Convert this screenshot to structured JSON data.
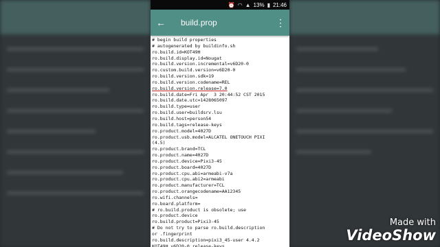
{
  "status_bar": {
    "battery": "13%",
    "time": "21:46"
  },
  "toolbar": {
    "back_icon": "arrow-left-icon",
    "title": "build.prop",
    "menu_icon": "more-vert-icon"
  },
  "lines": [
    "# begin build properties",
    "# autogenerated by buildinfo.sh",
    "ro.build.id=KOT49H",
    "ro.build.display.id=Nougat",
    "ro.build.version.incremental=v6D20-0",
    "ro.custom.build.version=v6D20-0",
    "ro.build.version.sdk=19",
    "ro.build.version.codename=REL",
    "ro.build.version.release=7.0",
    "ro.build.date=Fri Apr  3 20:44:52 CST 2015",
    "ro.build.date.utc=1428065097",
    "ro.build.type=user",
    "ro.build.user=buildsrv.lsu",
    "ro.build.host=person54",
    "ro.build.tags=release-keys",
    "ro.product.model=4027D",
    "ro.product.usb.model=ALCATEL ONETOUCH PIXI",
    "(4.5)",
    "ro.product.brand=TCL",
    "ro.product.name=4027D",
    "ro.product.device=Pixi3-45",
    "ro.product.board=4027D",
    "ro.product.cpu.abi=armeabi-v7a",
    "ro.product.cpu.abi2=armeabi",
    "ro.product.manufacturer=TCL",
    "ro.product.orangecodename=AA12345",
    "ro.wifi.channels=",
    "ro.board.platform=",
    "# ro.build.product is obsolete; use",
    "ro.product.device",
    "ro.build.product=Pixi3-45",
    "# Do not try to parse ro.build.description",
    "or .fingerprint",
    "ro.build.description=pixi3_45-user 4.4.2",
    "KOT49H v6D20-0 release-keys"
  ],
  "highlighted_line_index": 8,
  "watermark": {
    "line1": "Made with",
    "line2": "VideoShow"
  }
}
